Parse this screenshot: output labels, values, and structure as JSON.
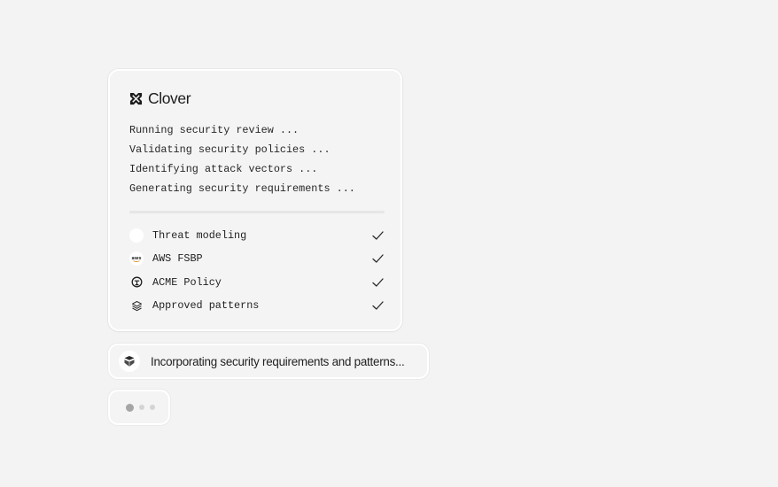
{
  "brand": {
    "name": "Clover",
    "logo_icon": "clover-x-logo-icon"
  },
  "log": [
    "Running security review ...",
    "Validating security policies ...",
    "Identifying attack vectors ...",
    "Generating security requirements ..."
  ],
  "checks": [
    {
      "label": "Threat modeling",
      "icon": "blank-circle-icon",
      "status": "done"
    },
    {
      "label": "AWS FSBP",
      "icon": "aws-logo-icon",
      "icon_text": "aws",
      "status": "done"
    },
    {
      "label": "ACME Policy",
      "icon": "acme-logo-icon",
      "status": "done"
    },
    {
      "label": "Approved patterns",
      "icon": "layers-icon",
      "status": "done"
    }
  ],
  "status": {
    "text": "Incorporating security requirements and patterns...",
    "icon": "shield-stack-icon"
  },
  "typing_indicator": {
    "dots": 3,
    "active_dot": 1
  },
  "colors": {
    "background": "#f3f3f3",
    "card": "#f4f4f4",
    "card_border": "#ffffff",
    "text": "#1e1e1e",
    "dot_active": "#a5a5a5",
    "dot_inactive": "#d4d4d4"
  }
}
